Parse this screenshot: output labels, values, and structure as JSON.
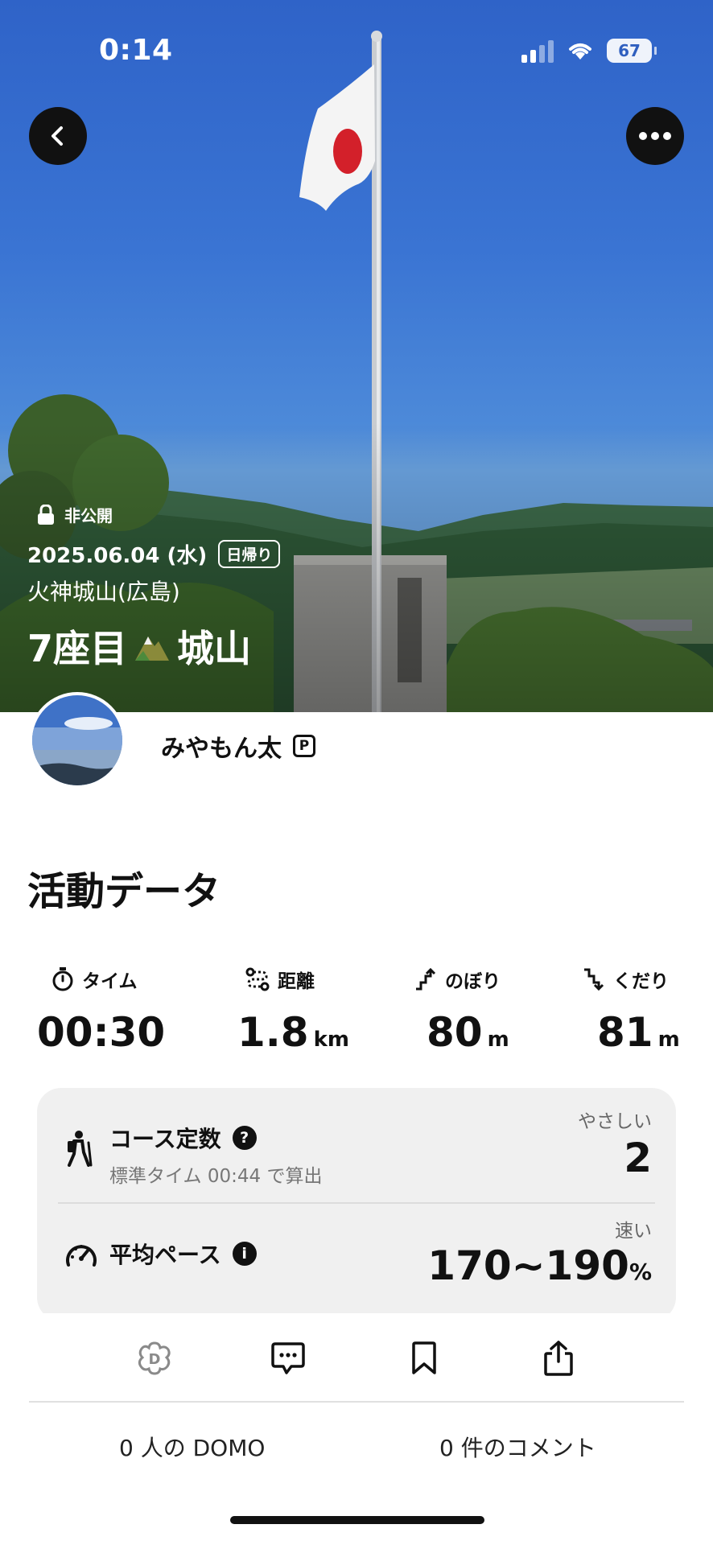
{
  "status_bar": {
    "time": "0:14",
    "battery": "67"
  },
  "hero": {
    "privacy_label": "非公開",
    "date": "2025.06.04 (水)",
    "trip_type": "日帰り",
    "place": "火神城山(広島)",
    "title_prefix": "7座目",
    "title_suffix": "城山"
  },
  "profile": {
    "username": "みやもん太",
    "badge": "P"
  },
  "activity": {
    "section_title": "活動データ",
    "stats": [
      {
        "label": "タイム",
        "value": "00:30",
        "unit": ""
      },
      {
        "label": "距離",
        "value": "1.8",
        "unit": "km"
      },
      {
        "label": "のぼり",
        "value": "80",
        "unit": "m"
      },
      {
        "label": "くだり",
        "value": "81",
        "unit": "m"
      }
    ],
    "course": {
      "title": "コース定数",
      "help": "?",
      "subtitle": "標準タイム 00:44 で算出",
      "level": "やさしい",
      "value": "2"
    },
    "pace": {
      "title": "平均ペース",
      "help": "i",
      "level": "速い",
      "value": "170~190",
      "unit": "%"
    }
  },
  "footer": {
    "domo_count": "0 人の DOMO",
    "comment_count": "0 件のコメント"
  }
}
